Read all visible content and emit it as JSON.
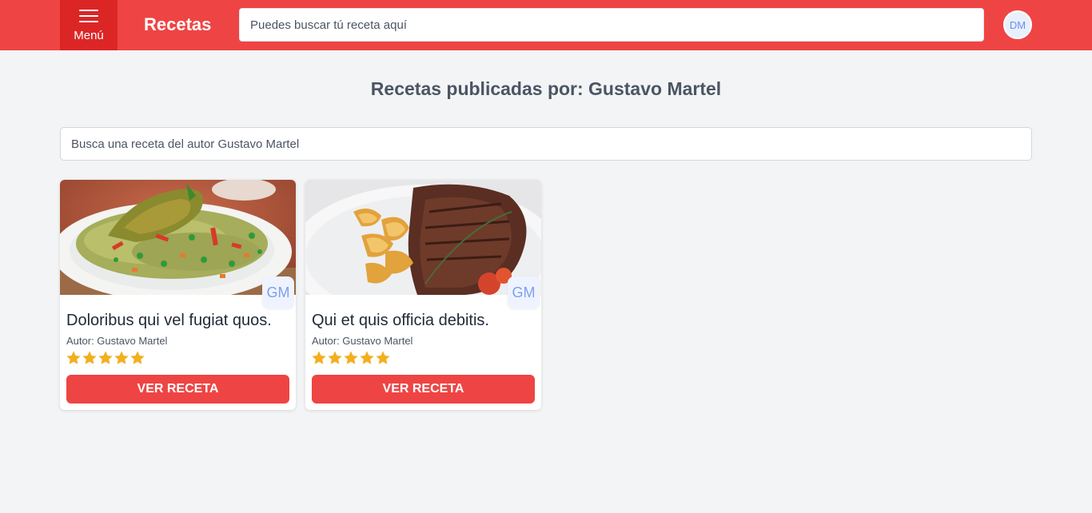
{
  "header": {
    "menu_label": "Menú",
    "brand": "Recetas",
    "search_placeholder": "Puedes buscar tú receta aquí",
    "user_initials": "DM"
  },
  "main": {
    "title": "Recetas publicadas por: Gustavo Martel",
    "author_search_placeholder": "Busca una receta del autor Gustavo Martel"
  },
  "recipes": [
    {
      "title": "Doloribus qui vel fugiat quos.",
      "author": "Autor: Gustavo Martel",
      "badge": "GM",
      "rating": 5,
      "button": "VER RECETA",
      "image": "green-rice-with-chicken"
    },
    {
      "title": "Qui et quis officia debitis.",
      "author": "Autor: Gustavo Martel",
      "badge": "GM",
      "rating": 5,
      "button": "VER RECETA",
      "image": "steak-with-potato-wedges"
    }
  ],
  "colors": {
    "accent": "#ef4444",
    "accent_dark": "#dc2626",
    "star": "#f2b01e",
    "background": "#f3f4f6"
  }
}
